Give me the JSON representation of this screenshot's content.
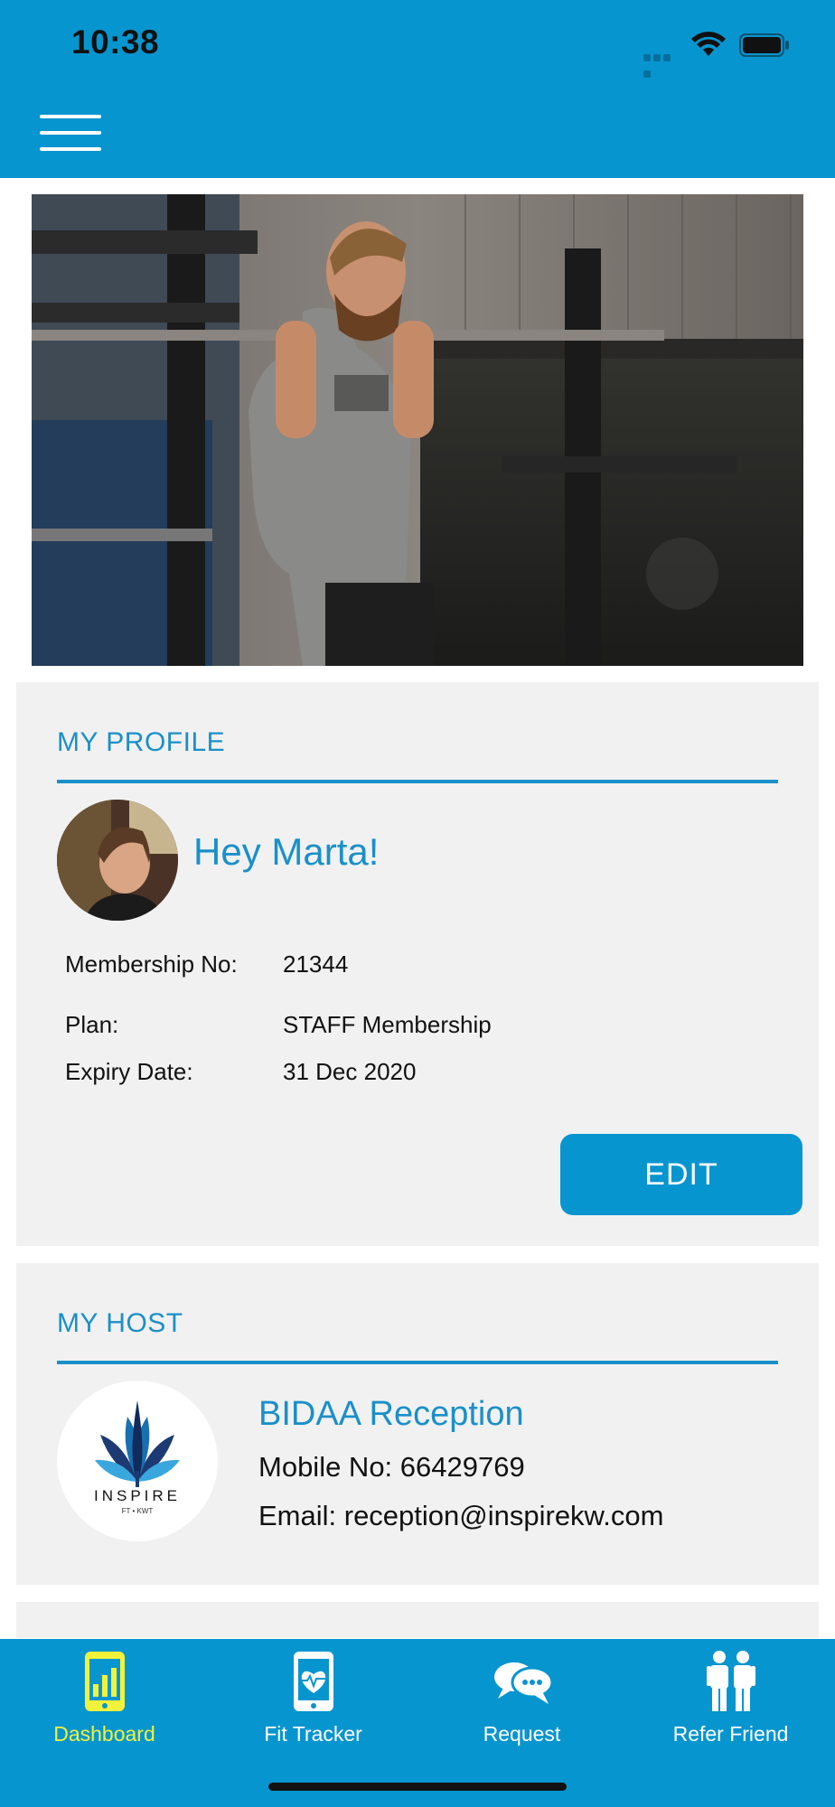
{
  "status_bar": {
    "time": "10:38"
  },
  "profile": {
    "section_title": "MY PROFILE",
    "greeting": "Hey Marta!",
    "rows": [
      {
        "label": "Membership No:",
        "value": "21344"
      },
      {
        "label": "Plan:",
        "value": "STAFF Membership"
      },
      {
        "label": "Expiry Date:",
        "value": "31 Dec 2020"
      }
    ],
    "edit_label": "EDIT"
  },
  "host": {
    "section_title": "MY HOST",
    "logo_text": "INSPIRE",
    "logo_subtext": "FT • KWT",
    "name": "BIDAA Reception",
    "mobile": "Mobile No: 66429769",
    "email": "Email: reception@inspirekw.com"
  },
  "bottom_nav": {
    "items": [
      {
        "label": "Dashboard",
        "icon": "dashboard-phone-icon",
        "active": true
      },
      {
        "label": "Fit Tracker",
        "icon": "heartbeat-phone-icon",
        "active": false
      },
      {
        "label": "Request",
        "icon": "chat-bubbles-icon",
        "active": false
      },
      {
        "label": "Refer Friend",
        "icon": "people-icon",
        "active": false
      }
    ]
  },
  "colors": {
    "brand_blue": "#0795cf",
    "title_blue": "#1a90c8",
    "active_nav": "#f2f23a",
    "card_bg": "#f1f1f1"
  }
}
